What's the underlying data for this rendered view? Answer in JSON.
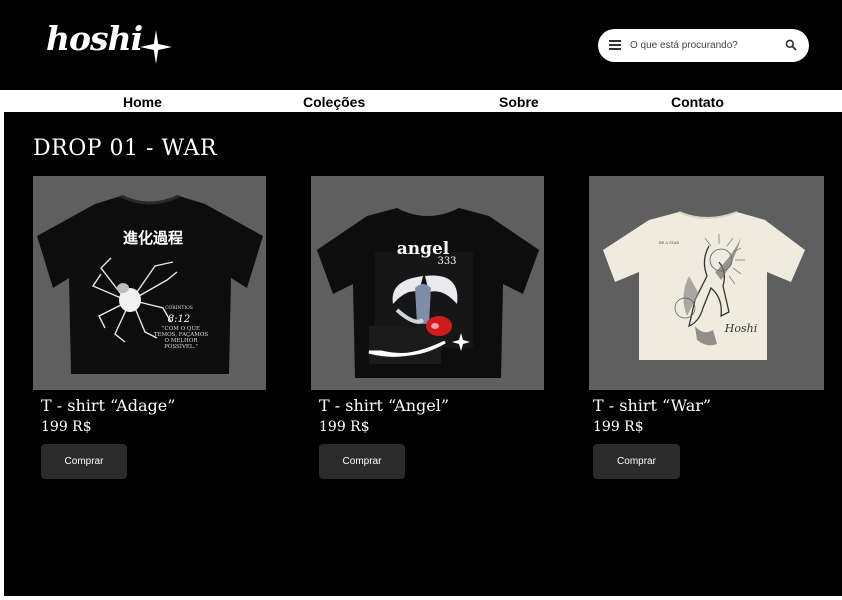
{
  "brand": {
    "name": "hoshi"
  },
  "search": {
    "placeholder": "O que está procurando?"
  },
  "nav": {
    "items": [
      {
        "label": "Home"
      },
      {
        "label": "Coleções"
      },
      {
        "label": "Sobre"
      },
      {
        "label": "Contato"
      }
    ]
  },
  "section": {
    "title": "DROP 01 - WAR"
  },
  "products": [
    {
      "name": "T - shirt “Adage”",
      "price": "199 R$",
      "button": "Comprar",
      "image": {
        "title": "進化過程",
        "sub": "CORINTIOS",
        "verse": "8:12",
        "quote1": "\"COM O QUE",
        "quote2": "TEMOS, FAÇAMOS",
        "quote3": "O MELHOR",
        "quote4": "POSSÍVEL.\""
      }
    },
    {
      "name": "T - shirt “Angel”",
      "price": "199 R$",
      "button": "Comprar",
      "image": {
        "title": "angel",
        "number": "333"
      }
    },
    {
      "name": "T - shirt “War”",
      "price": "199 R$",
      "button": "Comprar",
      "image": {
        "tag": "BE A STAR",
        "signature": "Hoshi"
      }
    }
  ],
  "colors": {
    "header": "#000000",
    "nav": "#ffffff",
    "main": "#000000",
    "image_bg": "#5f5f5f",
    "button": "#2b2b2b",
    "shirt_light": "#efecdf"
  },
  "icons": {
    "menu": "menu-icon",
    "search": "search-icon",
    "star": "sparkle-star-icon"
  }
}
